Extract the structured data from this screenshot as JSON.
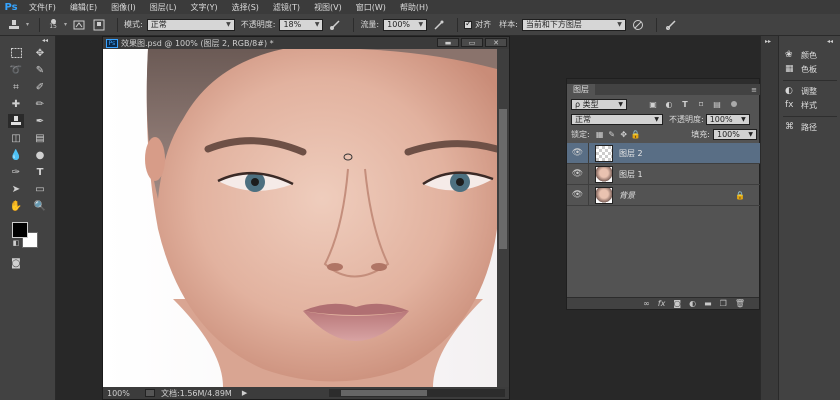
{
  "menubar": {
    "logo": "Ps",
    "items": [
      "文件(F)",
      "编辑(E)",
      "图像(I)",
      "图层(L)",
      "文字(Y)",
      "选择(S)",
      "滤镜(T)",
      "视图(V)",
      "窗口(W)",
      "帮助(H)"
    ]
  },
  "options": {
    "brush_size": "15",
    "mode_label": "模式:",
    "mode_value": "正常",
    "opacity_label": "不透明度:",
    "opacity_value": "18%",
    "flow_label": "流量:",
    "flow_value": "100%",
    "align_label": "对齐",
    "sample_label": "样本:",
    "sample_value": "当前和下方图层"
  },
  "document": {
    "badge": "Ps",
    "title": "效果图.psd @ 100% (图层 2, RGB/8#) *",
    "zoom": "100%",
    "doc_info": "文档:1.56M/4.89M"
  },
  "layers_panel": {
    "tab_label": "图层",
    "filter_label": "ρ 类型",
    "blend_mode": "正常",
    "opacity_label": "不透明度:",
    "opacity_value": "100%",
    "lock_label": "锁定:",
    "fill_label": "填充:",
    "fill_value": "100%",
    "layers": [
      {
        "name": "图层 2",
        "selected": true
      },
      {
        "name": "图层 1",
        "selected": false
      },
      {
        "name": "背景",
        "selected": false
      }
    ]
  },
  "right_panels": [
    {
      "icon": "color-icon",
      "label": "颜色"
    },
    {
      "icon": "swatches-icon",
      "label": "色板"
    },
    {
      "icon": "adjustments-icon",
      "label": "调整"
    },
    {
      "icon": "styles-icon",
      "label": "样式"
    },
    {
      "icon": "paths-icon",
      "label": "路径"
    }
  ],
  "colors": {
    "accent": "#35a4ff",
    "selected_layer": "#596e85",
    "foreground": "#000000",
    "background": "#ffffff"
  }
}
